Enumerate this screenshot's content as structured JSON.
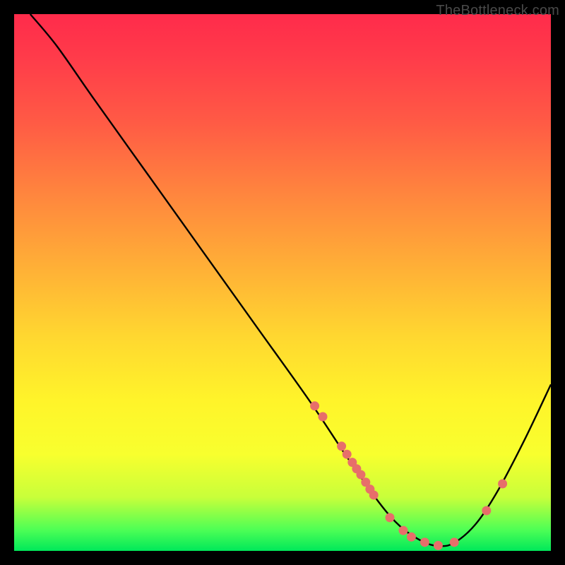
{
  "watermark": "TheBottleneck.com",
  "chart_data": {
    "type": "line",
    "title": "",
    "xlabel": "",
    "ylabel": "",
    "xlim": [
      0,
      100
    ],
    "ylim": [
      0,
      100
    ],
    "curve": [
      {
        "x": 3.0,
        "y": 100.0
      },
      {
        "x": 8.0,
        "y": 94.0
      },
      {
        "x": 15.0,
        "y": 84.0
      },
      {
        "x": 25.0,
        "y": 70.0
      },
      {
        "x": 35.0,
        "y": 56.0
      },
      {
        "x": 45.0,
        "y": 42.0
      },
      {
        "x": 55.0,
        "y": 28.0
      },
      {
        "x": 62.0,
        "y": 17.5
      },
      {
        "x": 68.0,
        "y": 9.0
      },
      {
        "x": 72.0,
        "y": 4.5
      },
      {
        "x": 76.0,
        "y": 1.8
      },
      {
        "x": 79.0,
        "y": 0.9
      },
      {
        "x": 82.0,
        "y": 1.5
      },
      {
        "x": 86.0,
        "y": 5.0
      },
      {
        "x": 90.0,
        "y": 11.0
      },
      {
        "x": 95.0,
        "y": 20.5
      },
      {
        "x": 100.0,
        "y": 31.0
      }
    ],
    "markers": [
      {
        "x": 56.0,
        "y": 27.0
      },
      {
        "x": 57.5,
        "y": 25.0
      },
      {
        "x": 61.0,
        "y": 19.5
      },
      {
        "x": 62.0,
        "y": 18.0
      },
      {
        "x": 63.0,
        "y": 16.5
      },
      {
        "x": 63.8,
        "y": 15.3
      },
      {
        "x": 64.6,
        "y": 14.2
      },
      {
        "x": 65.5,
        "y": 12.8
      },
      {
        "x": 66.3,
        "y": 11.5
      },
      {
        "x": 67.0,
        "y": 10.4
      },
      {
        "x": 70.0,
        "y": 6.2
      },
      {
        "x": 72.5,
        "y": 3.8
      },
      {
        "x": 74.0,
        "y": 2.6
      },
      {
        "x": 76.5,
        "y": 1.6
      },
      {
        "x": 79.0,
        "y": 1.0
      },
      {
        "x": 82.0,
        "y": 1.6
      },
      {
        "x": 88.0,
        "y": 7.5
      },
      {
        "x": 91.0,
        "y": 12.5
      }
    ],
    "gradient_stops": [
      {
        "pct": 0,
        "color": "#ff2b4b"
      },
      {
        "pct": 35,
        "color": "#ff8a3d"
      },
      {
        "pct": 72,
        "color": "#fff42a"
      },
      {
        "pct": 100,
        "color": "#00e85a"
      }
    ]
  }
}
